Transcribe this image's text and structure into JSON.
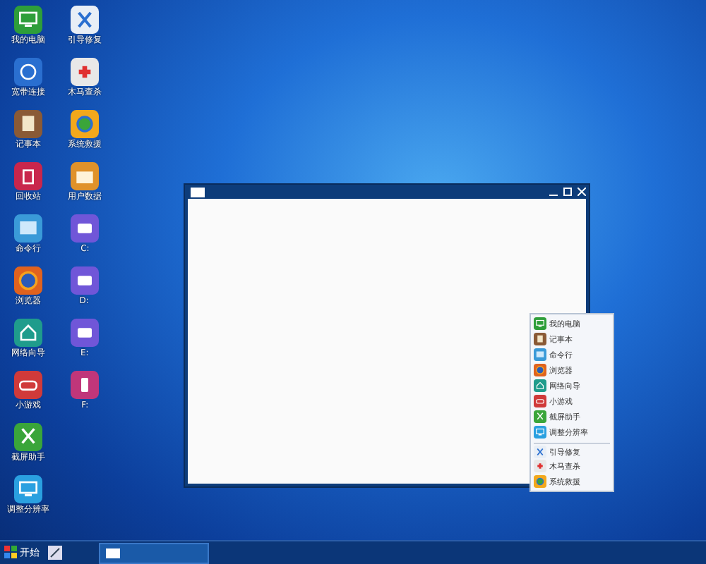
{
  "desktop_icons": [
    {
      "label": "我的电脑",
      "kind": "monitor",
      "color": "#2e9e3a"
    },
    {
      "label": "宽带连接",
      "kind": "globe",
      "color": "#2a6fd0"
    },
    {
      "label": "记事本",
      "kind": "note",
      "color": "#8a5a36"
    },
    {
      "label": "回收站",
      "kind": "bin",
      "color": "#c9264c"
    },
    {
      "label": "命令行",
      "kind": "terminal",
      "color": "#3a9ad8"
    },
    {
      "label": "浏览器",
      "kind": "browser",
      "color": "#e0621e"
    },
    {
      "label": "网络向导",
      "kind": "home",
      "color": "#1f9c8c"
    },
    {
      "label": "小游戏",
      "kind": "game",
      "color": "#d03a3a"
    },
    {
      "label": "截屏助手",
      "kind": "scissors",
      "color": "#3aa53a"
    },
    {
      "label": "调整分辨率",
      "kind": "monitor",
      "color": "#2aa0e0"
    },
    {
      "label": "引导修复",
      "kind": "tools",
      "color": "#e8eef6"
    },
    {
      "label": "木马查杀",
      "kind": "kit",
      "color": "#e8e8e8"
    },
    {
      "label": "系统救援",
      "kind": "wheel",
      "color": "#f2a81c"
    },
    {
      "label": "用户数据",
      "kind": "folder",
      "color": "#e0922a"
    },
    {
      "label": "C:",
      "kind": "drive",
      "color": "#7056d8"
    },
    {
      "label": "D:",
      "kind": "drive",
      "color": "#7056d8"
    },
    {
      "label": "E:",
      "kind": "drive",
      "color": "#7056d8"
    },
    {
      "label": "F:",
      "kind": "usb",
      "color": "#c0367a"
    }
  ],
  "menu": [
    {
      "label": "我的电脑",
      "kind": "monitor",
      "color": "#2e9e3a"
    },
    {
      "label": "记事本",
      "kind": "note",
      "color": "#8a5a36"
    },
    {
      "label": "命令行",
      "kind": "terminal",
      "color": "#3a9ad8"
    },
    {
      "label": "浏览器",
      "kind": "browser",
      "color": "#e0621e"
    },
    {
      "label": "网络向导",
      "kind": "home",
      "color": "#1f9c8c"
    },
    {
      "label": "小游戏",
      "kind": "game",
      "color": "#d03a3a"
    },
    {
      "label": "截屏助手",
      "kind": "scissors",
      "color": "#3aa53a"
    },
    {
      "label": "调整分辨率",
      "kind": "monitor",
      "color": "#2aa0e0"
    },
    {
      "label": "引导修复",
      "kind": "tools",
      "color": "#e8eef6",
      "separator": true
    },
    {
      "label": "木马查杀",
      "kind": "kit",
      "color": "#e8e8e8"
    },
    {
      "label": "系统救援",
      "kind": "wheel",
      "color": "#f2a81c"
    }
  ],
  "taskbar": {
    "start": "开始"
  }
}
